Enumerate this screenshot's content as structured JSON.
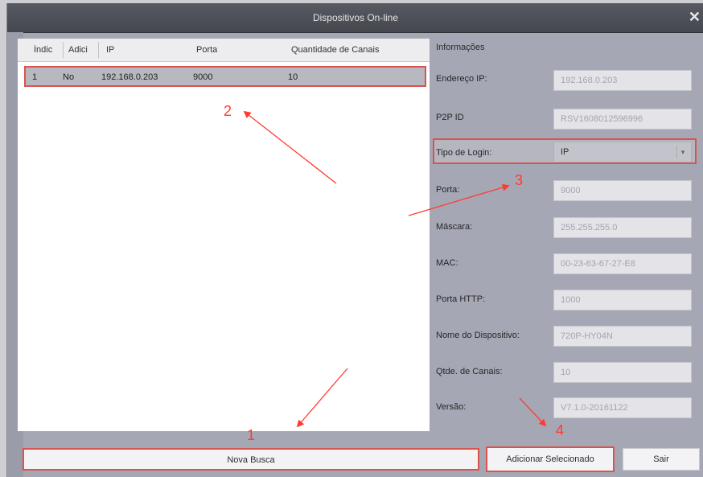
{
  "window": {
    "title": "Dispositivos On-line"
  },
  "table": {
    "columns": [
      "Índic",
      "Adici",
      "IP",
      "Porta",
      "Quantidade de Canais"
    ],
    "rows": [
      {
        "index": "1",
        "added": "No",
        "ip": "192.168.0.203",
        "port": "9000",
        "channels": "10"
      }
    ]
  },
  "info": {
    "title": "Informações",
    "fields": {
      "ip": {
        "label": "Endereço IP:",
        "value": "192.168.0.203"
      },
      "p2p": {
        "label": "P2P ID",
        "value": "RSV1608012596996"
      },
      "login": {
        "label": "Tipo de Login:",
        "value": "IP"
      },
      "port": {
        "label": "Porta:",
        "value": "9000"
      },
      "mask": {
        "label": "Máscara:",
        "value": "255.255.255.0"
      },
      "mac": {
        "label": "MAC:",
        "value": "00-23-63-67-27-E8"
      },
      "http": {
        "label": "Porta HTTP:",
        "value": "1000"
      },
      "name": {
        "label": "Nome do Dispositivo:",
        "value": "720P-HY04N"
      },
      "channels": {
        "label": "Qtde. de Canais:",
        "value": "10"
      },
      "version": {
        "label": "Versão:",
        "value": "V7.1.0-20161122"
      }
    }
  },
  "buttons": {
    "new_search": "Nova Busca",
    "add_selected": "Adicionar Selecionado",
    "exit": "Sair"
  },
  "annotations": [
    "1",
    "2",
    "3",
    "4"
  ],
  "colors": {
    "annotation": "#ff3b30",
    "highlight_border": "#d9534f"
  }
}
